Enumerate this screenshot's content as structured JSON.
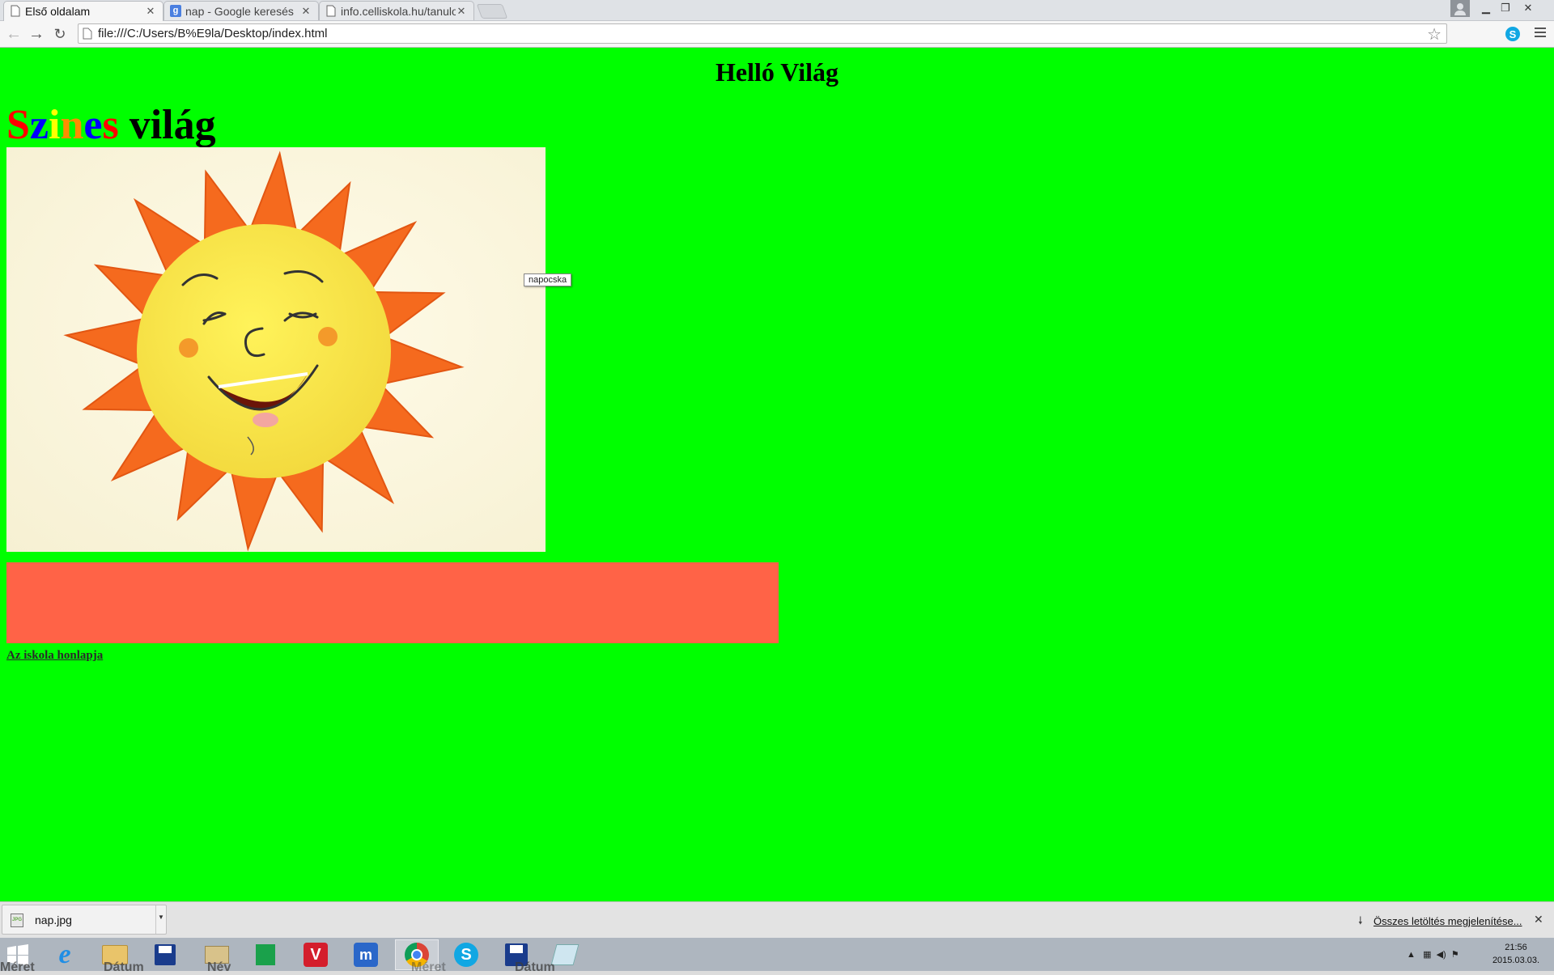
{
  "browser": {
    "tabs": [
      {
        "title": "Első oldalam",
        "active": true
      },
      {
        "title": "nap - Google keresés",
        "active": false
      },
      {
        "title": "info.celliskola.hu/tanulo",
        "active": false
      }
    ],
    "address": "file:///C:/Users/B%E9la/Desktop/index.html"
  },
  "page": {
    "heading": "Helló Világ",
    "colorful_title": {
      "letters": [
        {
          "char": "S",
          "color": "#ff0000"
        },
        {
          "char": "z",
          "color": "#0000ff"
        },
        {
          "char": "i",
          "color": "#ffff00"
        },
        {
          "char": "n",
          "color": "#ff8c00"
        },
        {
          "char": "e",
          "color": "#0000ff"
        },
        {
          "char": "s",
          "color": "#ff0000"
        }
      ],
      "rest": "világ"
    },
    "image_tooltip": "napocska",
    "link_text": "Az iskola honlapja",
    "background_color": "#00ff00",
    "box_color": "#ff6347"
  },
  "downloads": {
    "file_name": "nap.jpg",
    "file_type": "JPG",
    "show_all": "Összes letöltés megjelenítése..."
  },
  "taskbar": {
    "ghost_labels": [
      "Méret",
      "Dátum",
      "Név",
      "Méret",
      "Dátum"
    ],
    "time": "21:56",
    "date": "2015.03.03."
  }
}
